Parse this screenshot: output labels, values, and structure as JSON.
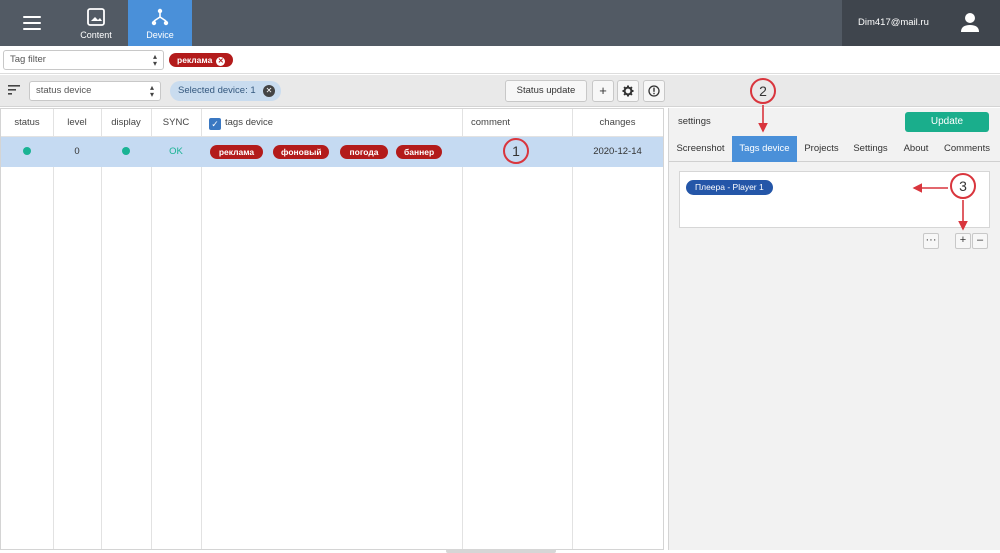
{
  "topbar": {
    "nav": [
      {
        "label": "Content",
        "icon": "image-icon"
      },
      {
        "label": "Device",
        "icon": "network-icon",
        "active": true
      }
    ],
    "user_email": "Dim417@mail.ru",
    "accent_color": "#4a90d9",
    "bar_color": "#525a64"
  },
  "filters": {
    "tag_filter_placeholder": "Tag filter",
    "active_tag": "реклама"
  },
  "toolbar": {
    "status_select": "status device",
    "selected_label": "Selected device: 1",
    "status_update_label": "Status update",
    "add_label": "+"
  },
  "table": {
    "columns": [
      "status",
      "level",
      "display",
      "SYNC",
      "tags device",
      "comment",
      "changes"
    ],
    "rows": [
      {
        "status": "online",
        "level": "0",
        "display": "on",
        "sync": "OK",
        "tags": [
          "реклама",
          "фоновый",
          "погода",
          "баннер"
        ],
        "comment": "",
        "changes": "2020-12-14"
      }
    ],
    "status_color": "#1ab394",
    "tag_color": "#b31b1b",
    "row_selected_color": "#c5daf2"
  },
  "panel": {
    "title": "settings",
    "update_label": "Update",
    "tabs": [
      "Screenshot",
      "Tags device",
      "Projects",
      "Settings",
      "About",
      "Comments"
    ],
    "active_tab": "Tags device",
    "device_tag": "Плеера - Player 1",
    "more_label": "···",
    "plus_label": "+",
    "minus_label": "–"
  },
  "annotations": {
    "markers": [
      "1",
      "2",
      "3"
    ],
    "color": "#d9353d"
  }
}
